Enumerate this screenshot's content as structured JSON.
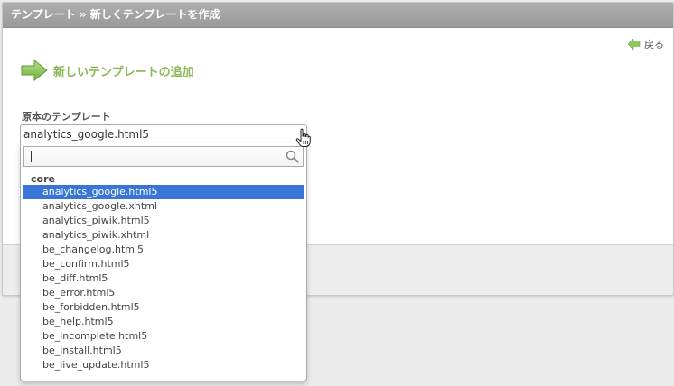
{
  "title": "テンプレート » 新しくテンプレートを作成",
  "back_label": "戻る",
  "heading": "新しいテンプレートの追加",
  "field_label": "原本のテンプレート",
  "select": {
    "value": "analytics_google.html5",
    "search_value": "",
    "group": "core",
    "options": [
      {
        "label": "analytics_google.html5",
        "selected": true
      },
      {
        "label": "analytics_google.xhtml",
        "selected": false
      },
      {
        "label": "analytics_piwik.html5",
        "selected": false
      },
      {
        "label": "analytics_piwik.xhtml",
        "selected": false
      },
      {
        "label": "be_changelog.html5",
        "selected": false
      },
      {
        "label": "be_confirm.html5",
        "selected": false
      },
      {
        "label": "be_diff.html5",
        "selected": false
      },
      {
        "label": "be_error.html5",
        "selected": false
      },
      {
        "label": "be_forbidden.html5",
        "selected": false
      },
      {
        "label": "be_help.html5",
        "selected": false
      },
      {
        "label": "be_incomplete.html5",
        "selected": false
      },
      {
        "label": "be_install.html5",
        "selected": false
      },
      {
        "label": "be_live_update.html5",
        "selected": false
      }
    ]
  },
  "colors": {
    "heading": "#8ab858",
    "arrow": "#8ec85e",
    "selected_option": "#3875d7",
    "titlebar": "#a3a3a3"
  },
  "icons": {
    "back": "back-arrow-icon",
    "heading": "arrow-right-icon",
    "search": "search-icon",
    "cursor": "hand-cursor-icon"
  }
}
